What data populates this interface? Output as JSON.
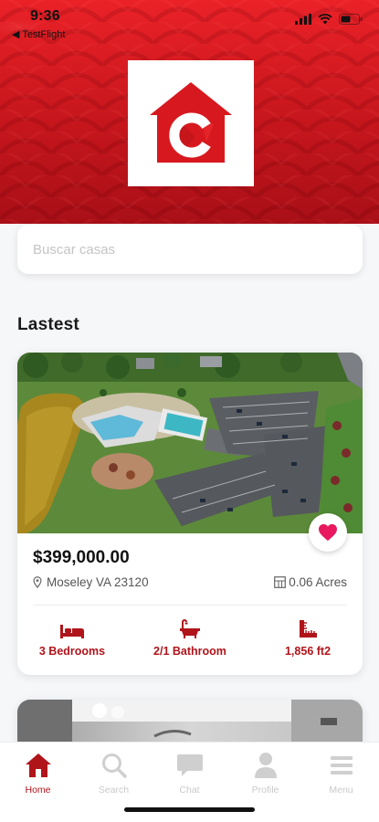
{
  "status_bar": {
    "time": "9:36",
    "back_app": "◀ TestFlight"
  },
  "brand": {
    "logo_letter": "C",
    "accent_color": "#d7191f",
    "accent_dark": "#b0141b"
  },
  "search": {
    "placeholder": "Buscar casas",
    "value": ""
  },
  "section": {
    "title": "Lastest"
  },
  "listing": {
    "price": "$399,000.00",
    "location": "Moseley VA 23120",
    "acreage": "0.06 Acres",
    "favorited": true,
    "features": [
      {
        "icon": "bed-icon",
        "label": "3 Bedrooms"
      },
      {
        "icon": "bathtub-icon",
        "label": "2/1 Bathroom"
      },
      {
        "icon": "area-icon",
        "label": "1,856 ft2"
      }
    ]
  },
  "tabbar": {
    "tabs": [
      {
        "label": "Home",
        "icon": "home-icon",
        "active": true
      },
      {
        "label": "Search",
        "icon": "search-icon",
        "active": false
      },
      {
        "label": "Chat",
        "icon": "chat-icon",
        "active": false
      },
      {
        "label": "Profile",
        "icon": "user-icon",
        "active": false
      },
      {
        "label": "Menu",
        "icon": "menu-icon",
        "active": false
      }
    ]
  }
}
